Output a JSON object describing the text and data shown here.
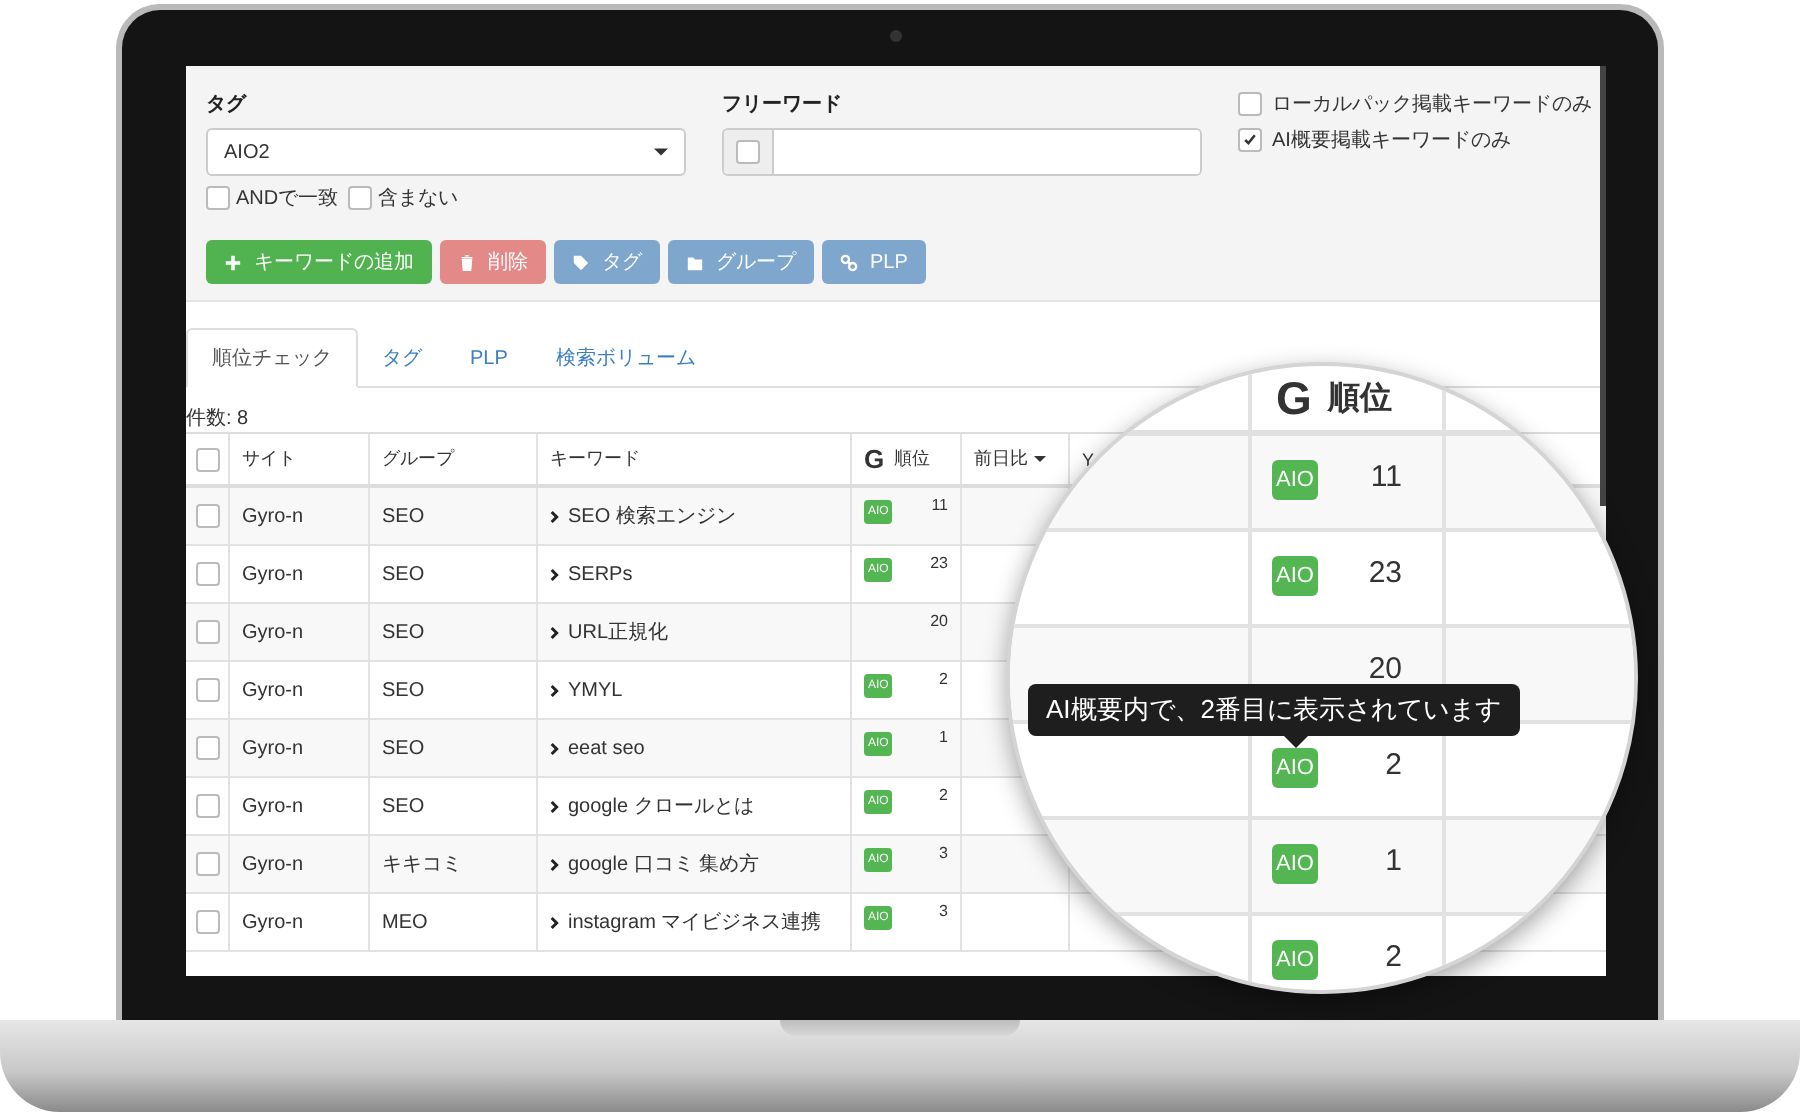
{
  "filters": {
    "tag": {
      "label": "タグ",
      "value": "AIO2"
    },
    "match_options": [
      {
        "label": "ANDで一致",
        "checked": false
      },
      {
        "label": "含まない",
        "checked": false
      }
    ],
    "freeword": {
      "label": "フリーワード",
      "checked": false
    },
    "options": [
      {
        "label": "ローカルパック掲載キーワードのみ",
        "checked": false
      },
      {
        "label": "AI概要掲載キーワードのみ",
        "checked": true
      }
    ]
  },
  "buttons": [
    {
      "label": "キーワードの追加",
      "kind": "add"
    },
    {
      "label": "削除",
      "kind": "delete"
    },
    {
      "label": "タグ",
      "kind": "tag"
    },
    {
      "label": "グループ",
      "kind": "group"
    },
    {
      "label": "PLP",
      "kind": "plp"
    }
  ],
  "tabs": [
    {
      "label": "順位チェック",
      "selected": true
    },
    {
      "label": "タグ",
      "selected": false
    },
    {
      "label": "PLP",
      "selected": false
    },
    {
      "label": "検索ボリューム",
      "selected": false
    }
  ],
  "count": "件数: 8",
  "table": {
    "columns": [
      {
        "kind": "checkbox",
        "checked": false
      },
      {
        "kind": "text",
        "label": "サイト"
      },
      {
        "kind": "text",
        "label": "グループ"
      },
      {
        "kind": "text",
        "label": "キーワード"
      },
      {
        "kind": "rank",
        "label": "順位",
        "logo": "G"
      },
      {
        "kind": "sort",
        "label": "前日比"
      },
      {
        "kind": "text",
        "label": "Y"
      }
    ],
    "rows": [
      {
        "checked": false,
        "site": "Gyro-n",
        "group": "SEO",
        "keyword": "SEO 検索エンジン",
        "badge": "AIO",
        "rank": "11"
      },
      {
        "checked": false,
        "site": "Gyro-n",
        "group": "SEO",
        "keyword": "SERPs",
        "badge": "AIO",
        "rank": "23"
      },
      {
        "checked": false,
        "site": "Gyro-n",
        "group": "SEO",
        "keyword": "URL正規化",
        "rank": "20"
      },
      {
        "checked": false,
        "site": "Gyro-n",
        "group": "SEO",
        "keyword": "YMYL",
        "badge": "AIO",
        "rank": "2"
      },
      {
        "checked": false,
        "site": "Gyro-n",
        "group": "SEO",
        "keyword": "eeat seo",
        "badge": "AIO",
        "rank": "1"
      },
      {
        "checked": false,
        "site": "Gyro-n",
        "group": "SEO",
        "keyword": "google クロールとは",
        "badge": "AIO",
        "rank": "2"
      },
      {
        "checked": false,
        "site": "Gyro-n",
        "group": "キキコミ",
        "keyword": "google 口コミ 集め方",
        "badge": "AIO",
        "rank": "3"
      },
      {
        "checked": false,
        "site": "Gyro-n",
        "group": "MEO",
        "keyword": "instagram マイビジネス連携",
        "badge": "AIO",
        "rank": "3"
      }
    ]
  },
  "magnifier": {
    "logo": "G",
    "header": "順位",
    "rows": [
      {
        "badge": "AIO",
        "rank": "11"
      },
      {
        "badge": "AIO",
        "rank": "23"
      },
      {
        "rank": "20"
      },
      {
        "badge": "AIO",
        "rank": "2"
      },
      {
        "badge": "AIO",
        "rank": "1"
      },
      {
        "badge": "AIO",
        "rank": "2"
      }
    ],
    "tooltip": "AI概要内で、2番目に表示されています"
  }
}
